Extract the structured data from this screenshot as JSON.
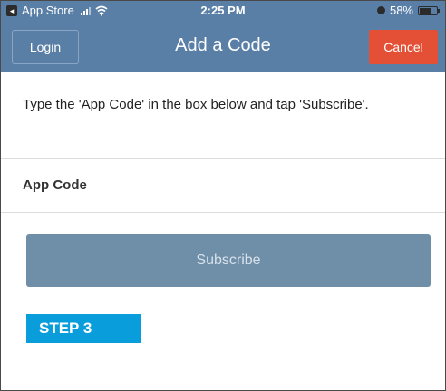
{
  "status_bar": {
    "back_app": "App Store",
    "time": "2:25 PM",
    "battery": "58%",
    "battery_level": 0.58
  },
  "nav": {
    "login_label": "Login",
    "title": "Add a Code",
    "cancel_label": "Cancel"
  },
  "main": {
    "instructions": "Type the 'App Code' in the box below and tap 'Subscribe'.",
    "field_label": "App Code",
    "code_value": "",
    "subscribe_label": "Subscribe"
  },
  "badge": {
    "label": "STEP 3"
  },
  "colors": {
    "nav_bg": "#5a7fa6",
    "cancel_bg": "#e35036",
    "subscribe_bg": "#6f8ea8",
    "step_badge_bg": "#0a9ddb"
  }
}
